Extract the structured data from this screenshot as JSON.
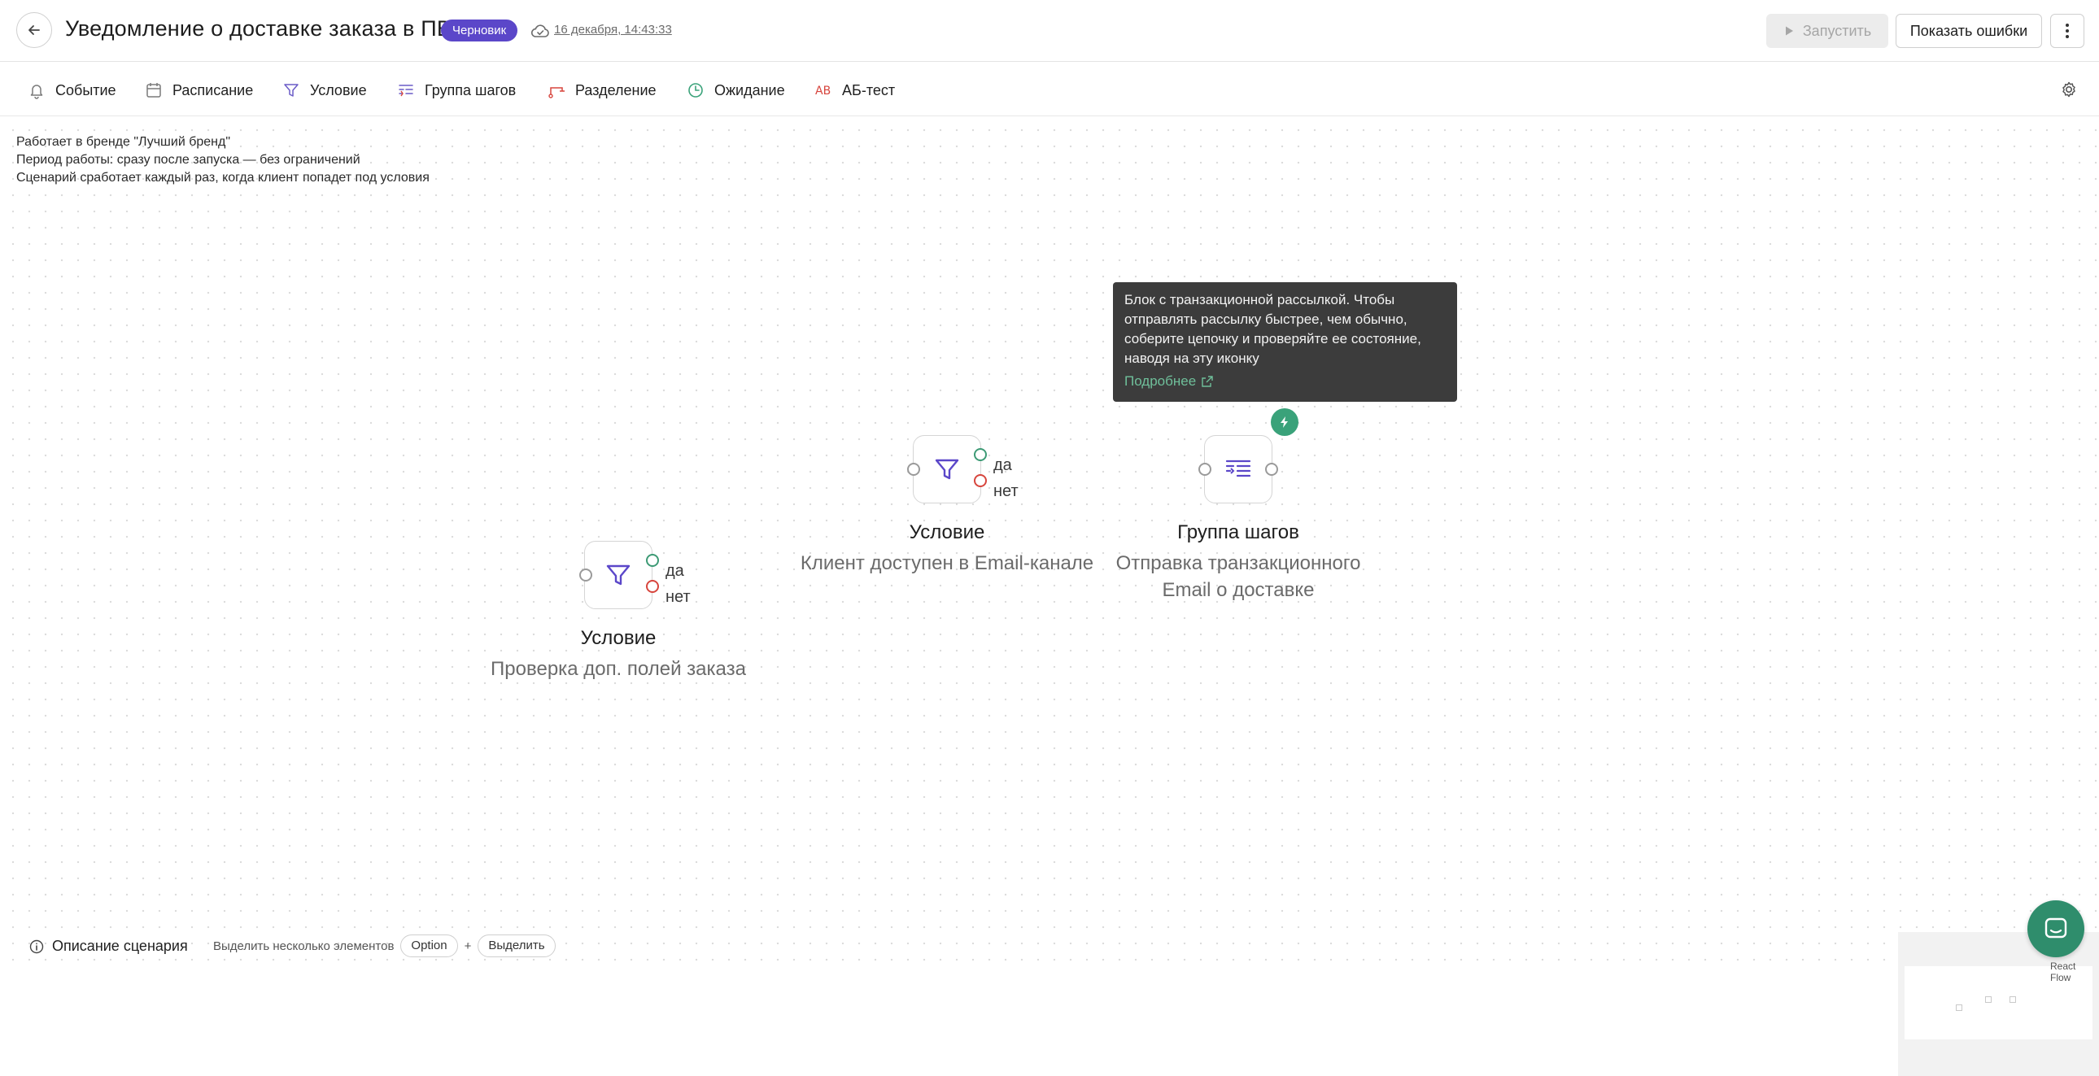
{
  "header": {
    "title": "Уведомление о доставке заказа в ПВЗ",
    "status": "Черновик",
    "saved_at": "16 декабря, 14:43:33",
    "run_label": "Запустить",
    "errors_label": "Показать ошибки"
  },
  "toolbar": {
    "items": [
      {
        "label": "Событие",
        "icon": "bell-icon"
      },
      {
        "label": "Расписание",
        "icon": "calendar-icon"
      },
      {
        "label": "Условие",
        "icon": "filter-icon"
      },
      {
        "label": "Группа шагов",
        "icon": "step-group-icon"
      },
      {
        "label": "Разделение",
        "icon": "split-icon"
      },
      {
        "label": "Ожидание",
        "icon": "clock-icon"
      },
      {
        "label": "АБ-тест",
        "icon": "ab-test-icon"
      }
    ]
  },
  "description": {
    "lines": [
      "Работает в бренде \"Лучший бренд\"",
      "Период работы: сразу после запуска — без ограничений",
      "Сценарий сработает каждый раз, когда клиент попадет под условия"
    ]
  },
  "nodes": {
    "condition_1": {
      "title": "Условие",
      "subtitle": "Проверка доп. полей заказа",
      "yes": "да",
      "no": "нет"
    },
    "condition_2": {
      "title": "Условие",
      "subtitle": "Клиент доступен в Email-канале",
      "yes": "да",
      "no": "нет"
    },
    "group": {
      "title": "Группа шагов",
      "subtitle_lines": [
        "Отправка транзакционного",
        "Email о доставке"
      ]
    }
  },
  "tooltip": {
    "lines": [
      "Блок с транзакционной рассылкой. Чтобы",
      "отправлять рассылку быстрее, чем обычно,",
      "соберите цепочку и проверяйте ее состояние,",
      "наводя на эту иконку"
    ],
    "link": "Подробнее"
  },
  "footer": {
    "scenario_desc": "Описание сценария",
    "multi_select_hint": "Выделить несколько элементов",
    "key_option": "Option",
    "plus": "+",
    "key_select": "Выделить"
  },
  "minimap": {
    "attribution": "React Flow"
  },
  "colors": {
    "accent": "#5b47c9",
    "success": "#3aa27a",
    "danger": "#d7453d",
    "tooltip_bg": "#3c3c3c"
  }
}
